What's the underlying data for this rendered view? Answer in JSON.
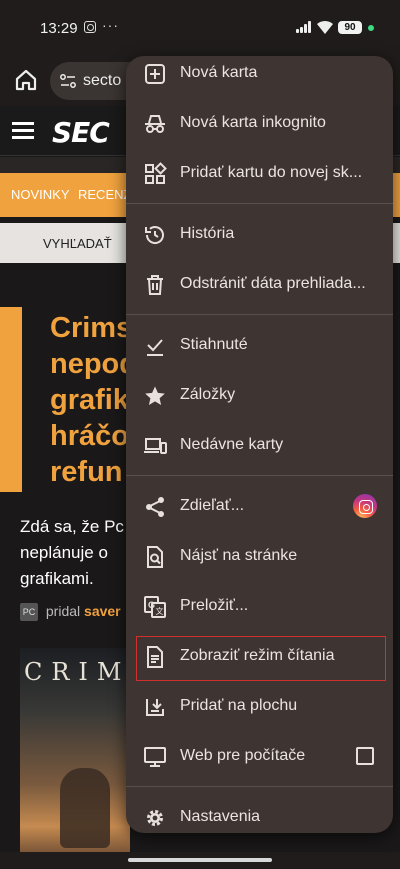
{
  "status_bar": {
    "time": "13:29",
    "more": "···",
    "battery": "90"
  },
  "toolbar": {
    "url_text": "secto"
  },
  "site": {
    "logo": "SEC",
    "nav": [
      "NOVINKY",
      "RECENZ"
    ],
    "subnav": "VYHĽADAŤ",
    "headline_lines": [
      "Crims",
      "nepod",
      "grafik",
      "hráčo",
      "refun"
    ],
    "lede_lines": [
      "Zdá sa, že Pc",
      "neplánuje o",
      "grafikami."
    ],
    "author_badge": "PC",
    "author_prefix": "pridal",
    "author_name": "saver",
    "image_title": "CRIM"
  },
  "menu": {
    "items": [
      {
        "label": "Nová karta",
        "icon": "new-tab-icon"
      },
      {
        "label": "Nová karta inkognito",
        "icon": "incognito-icon"
      },
      {
        "label": "Pridať kartu do novej sk...",
        "icon": "tab-group-icon"
      },
      {
        "label": "História",
        "icon": "history-icon"
      },
      {
        "label": "Odstrániť dáta prehliada...",
        "icon": "trash-icon"
      },
      {
        "label": "Stiahnuté",
        "icon": "download-icon"
      },
      {
        "label": "Záložky",
        "icon": "star-icon"
      },
      {
        "label": "Nedávne karty",
        "icon": "devices-icon"
      },
      {
        "label": "Zdieľať...",
        "icon": "share-icon"
      },
      {
        "label": "Nájsť na stránke",
        "icon": "find-in-page-icon"
      },
      {
        "label": "Preložiť...",
        "icon": "translate-icon"
      },
      {
        "label": "Zobraziť režim čítania",
        "icon": "reader-mode-icon"
      },
      {
        "label": "Pridať na plochu",
        "icon": "add-to-home-icon"
      },
      {
        "label": "Web pre počítače",
        "icon": "desktop-icon"
      },
      {
        "label": "Nastavenia",
        "icon": "gear-icon"
      }
    ],
    "desktop_site_checked": false,
    "highlight_color": "#d32f2f"
  }
}
